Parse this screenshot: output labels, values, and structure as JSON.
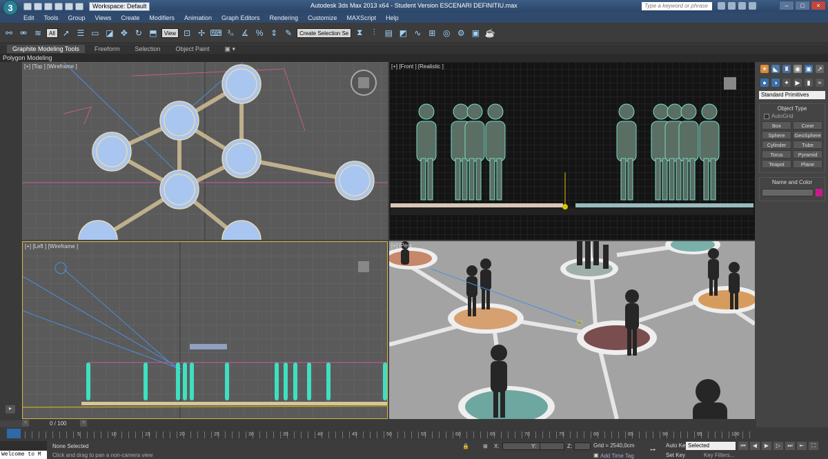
{
  "app": {
    "logo": "3",
    "title": "Autodesk 3ds Max 2013 x64 - Student Version   ESCENARI DEFINITIU.max",
    "workspace": "Workspace: Default",
    "search_placeholder": "Type a keyword or phrase"
  },
  "menu": [
    "Edit",
    "Tools",
    "Group",
    "Views",
    "Create",
    "Modifiers",
    "Animation",
    "Graph Editors",
    "Rendering",
    "Customize",
    "MAXScript",
    "Help"
  ],
  "toolbar": {
    "selection_filter": "All",
    "reference_coord": "View",
    "named_selection": "Create Selection Se"
  },
  "ribbon": {
    "tabs": [
      "Graphite Modeling Tools",
      "Freeform",
      "Selection",
      "Object Paint"
    ],
    "active_tab": "Graphite Modeling Tools",
    "sub_label": "Polygon Modeling"
  },
  "viewports": {
    "top": "[+] [Top ] [Wireframe ]",
    "front": "[+] [Front ] [Realistic ]",
    "left": "[+] [Left ] [Wireframe ]",
    "perspective": "[+] [Pers"
  },
  "command_panel": {
    "category": "Standard Primitives",
    "object_type_title": "Object Type",
    "autogrid": "AutoGrid",
    "primitives": [
      "Box",
      "Cone",
      "Sphere",
      "GeoSphere",
      "Cylinder",
      "Tube",
      "Torus",
      "Pyramid",
      "Teapot",
      "Plane"
    ],
    "name_color_title": "Name and Color",
    "color": "#c91a8c"
  },
  "timeline": {
    "frame_label": "0 / 100",
    "ticks": [
      "5",
      "10",
      "15",
      "20",
      "25",
      "30",
      "35",
      "40",
      "45",
      "50",
      "55",
      "60",
      "65",
      "70",
      "75",
      "80",
      "85",
      "90",
      "95",
      "100"
    ]
  },
  "status": {
    "listener_text": "Welcome to M",
    "selection": "None Selected",
    "prompt": "Click and drag to pan a non-camera view",
    "x_label": "X:",
    "y_label": "Y:",
    "z_label": "Z:",
    "grid": "Grid = 2540,0cm",
    "add_time_tag": "Add Time Tag",
    "auto_key": "Auto Key",
    "key_mode": "Selected",
    "set_key": "Set Key",
    "key_filters": "Key Filters..."
  }
}
